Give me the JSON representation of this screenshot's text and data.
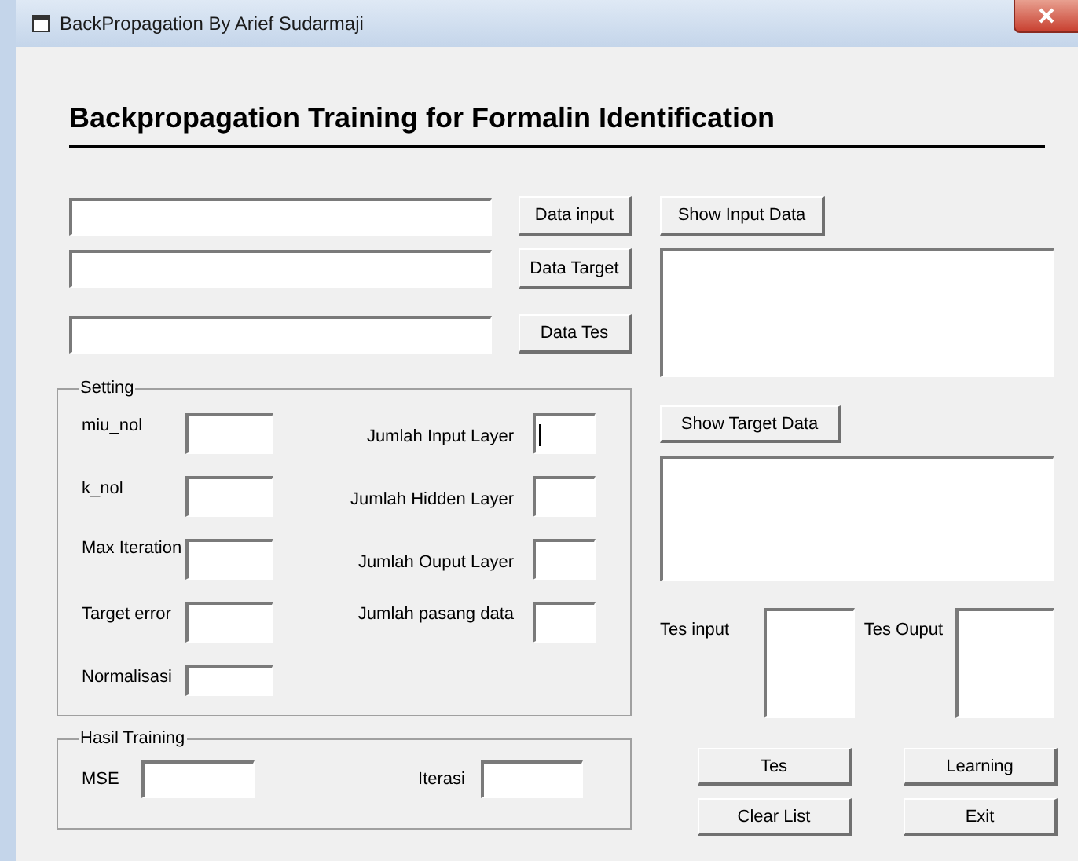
{
  "window": {
    "title": "BackPropagation By Arief Sudarmaji"
  },
  "heading": "Backpropagation Training for Formalin Identification",
  "file_rows": [
    {
      "button": "Data input"
    },
    {
      "button": "Data Target"
    },
    {
      "button": "Data Tes"
    }
  ],
  "input_panel": {
    "button": "Show Input Data"
  },
  "target_panel": {
    "button": "Show Target Data"
  },
  "setting": {
    "title": "Setting",
    "left_fields": [
      {
        "label": "miu_nol",
        "focused": false
      },
      {
        "label": "k_nol",
        "focused": false
      },
      {
        "label": "Max Iteration",
        "focused": false
      },
      {
        "label": "Target error",
        "focused": false
      },
      {
        "label": "Normalisasi",
        "focused": false
      }
    ],
    "right_fields": [
      {
        "label": "Jumlah Input Layer",
        "focused": true
      },
      {
        "label": "Jumlah Hidden Layer",
        "focused": false
      },
      {
        "label": "Jumlah Ouput Layer",
        "focused": false
      },
      {
        "label": "Jumlah pasang data",
        "focused": false
      }
    ]
  },
  "tes_boxes": [
    {
      "label": "Tes input"
    },
    {
      "label": "Tes Ouput"
    }
  ],
  "hasil_training": {
    "title": "Hasil Training",
    "fields": [
      {
        "label": "MSE"
      },
      {
        "label": "Iterasi"
      }
    ]
  },
  "buttons": [
    "Tes",
    "Learning",
    "Clear List",
    "Exit"
  ]
}
